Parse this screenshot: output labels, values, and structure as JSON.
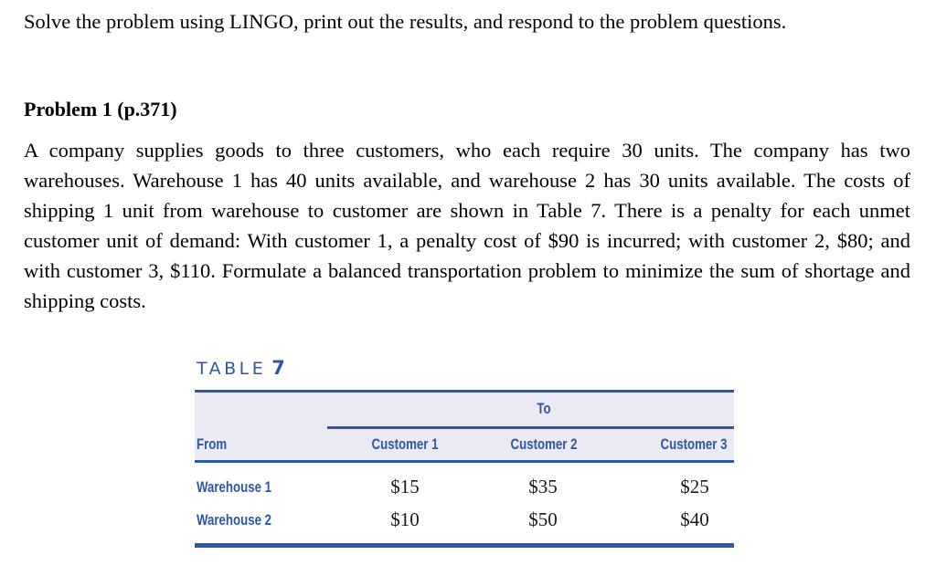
{
  "instruction": "Solve the problem using LINGO, print out the results, and respond to the problem questions.",
  "problem": {
    "title": "Problem 1 (p.371)",
    "text": "A company supplies goods to three customers, who each require 30 units. The company has two warehouses. Warehouse 1 has 40 units available, and warehouse 2 has 30 units available. The costs of shipping 1 unit from warehouse to customer are shown in Table 7. There is a penalty for each unmet customer unit of demand: With customer 1, a penalty cost of $90 is incurred; with customer 2, $80; and with customer 3, $110. Formulate a balanced transportation problem to minimize the sum of shortage and shipping costs."
  },
  "table": {
    "caption_label": "TABLE",
    "caption_number": "7",
    "group_header": "To",
    "row_header": "From",
    "columns": [
      "Customer 1",
      "Customer 2",
      "Customer 3"
    ],
    "rows": [
      {
        "label": "Warehouse 1",
        "values": [
          "$15",
          "$35",
          "$25"
        ]
      },
      {
        "label": "Warehouse 2",
        "values": [
          "$10",
          "$50",
          "$40"
        ]
      }
    ],
    "accent_color": "#2e56a6",
    "header_bg_color": "#ebeaf4"
  }
}
